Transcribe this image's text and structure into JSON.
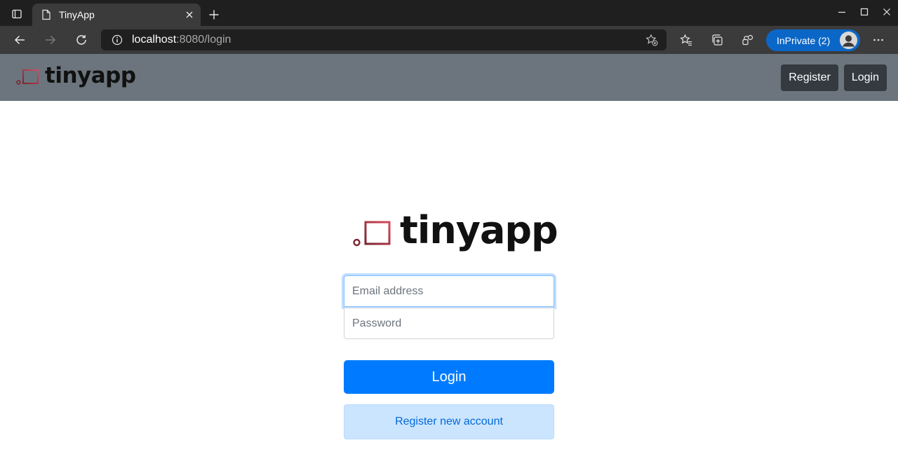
{
  "browser": {
    "tab_title": "TinyApp",
    "url_host": "localhost",
    "url_rest": ":8080/login",
    "inprivate_label": "InPrivate (2)",
    "icons": {
      "tab_actions": "tab-actions-icon",
      "favicon": "page-icon",
      "close": "close-icon",
      "new_tab": "plus-icon",
      "back": "back-arrow-icon",
      "forward": "forward-arrow-icon",
      "refresh": "refresh-icon",
      "info": "info-icon",
      "add_favorite": "star-plus-icon",
      "favorites": "favorites-icon",
      "collections": "collections-icon",
      "extensions": "extensions-icon",
      "more": "more-icon"
    }
  },
  "navbar": {
    "brand": "tinyapp",
    "register_label": "Register",
    "login_label": "Login"
  },
  "login": {
    "logo_text": "tinyapp",
    "email_placeholder": "Email address",
    "password_placeholder": "Password",
    "submit_label": "Login",
    "register_label": "Register new account"
  },
  "colors": {
    "navbar_bg": "#6c757d",
    "nav_button_bg": "#343a40",
    "primary": "#007bff",
    "register_bg": "#cce5ff",
    "logo_accent": "#c0394b"
  }
}
